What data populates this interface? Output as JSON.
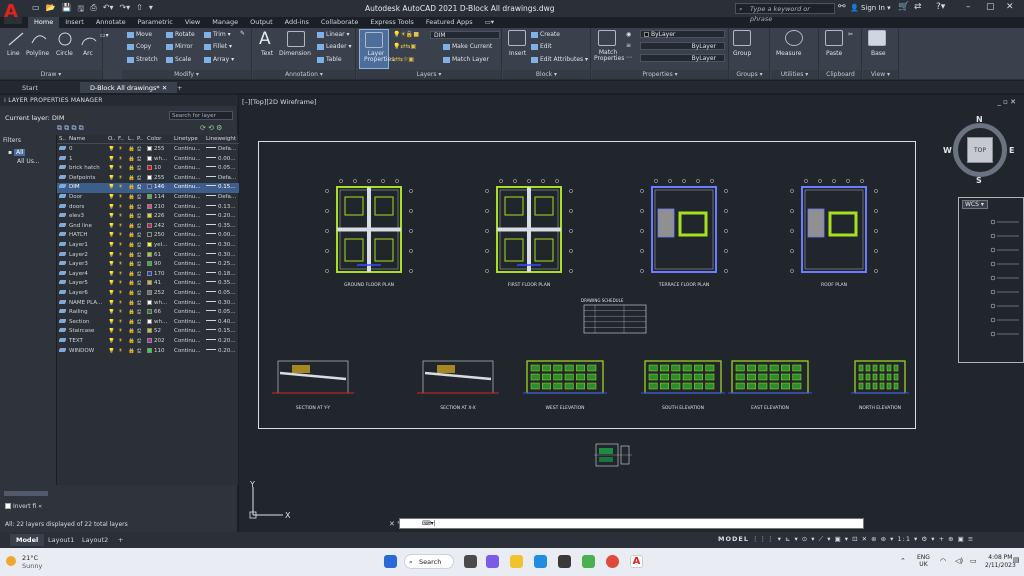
{
  "app": {
    "title": "Autodesk AutoCAD 2021   D-Block All drawings.dwg",
    "search_placeholder": "Type a keyword or phrase",
    "signin": "Sign In"
  },
  "ribbon_tabs": [
    "Home",
    "Insert",
    "Annotate",
    "Parametric",
    "View",
    "Manage",
    "Output",
    "Add-ins",
    "Collaborate",
    "Express Tools",
    "Featured Apps"
  ],
  "draw": {
    "line": "Line",
    "polyline": "Polyline",
    "circle": "Circle",
    "arc": "Arc",
    "label": "Draw ▾"
  },
  "modify": {
    "move": "Move",
    "rotate": "Rotate",
    "trim": "Trim ▾",
    "copy": "Copy",
    "mirror": "Mirror",
    "fillet": "Fillet ▾",
    "stretch": "Stretch",
    "scale": "Scale",
    "array": "Array ▾",
    "label": "Modify ▾"
  },
  "annotation": {
    "text": "Text",
    "dimension": "Dimension",
    "linear": "Linear ▾",
    "leader": "Leader ▾",
    "table": "Table",
    "label": "Annotation ▾"
  },
  "layers": {
    "layer_properties": "Layer Properties",
    "current": "DIM",
    "make_current": "Make Current",
    "match_layer": "Match Layer",
    "label": "Layers ▾"
  },
  "block": {
    "insert": "Insert",
    "create": "Create",
    "edit": "Edit",
    "edit_attributes": "Edit Attributes ▾",
    "label": "Block ▾"
  },
  "properties": {
    "match": "Match Properties",
    "color": "ByLayer",
    "linetype": "ByLayer",
    "lineweight": "ByLayer",
    "label": "Properties ▾"
  },
  "groups": {
    "group": "Group",
    "label": "Groups ▾"
  },
  "utilities": {
    "measure": "Measure",
    "label": "Utilities ▾"
  },
  "clipboard": {
    "paste": "Paste",
    "label": "Clipboard"
  },
  "view_panel": {
    "base": "Base",
    "label": "View ▾"
  },
  "doc_tabs": [
    "Start",
    "D-Block All drawings*"
  ],
  "lpm": {
    "title": "LAYER PROPERTIES MANAGER",
    "current": "Current layer: DIM",
    "search": "Search for layer",
    "filters_label": "Filters",
    "filter_all": "All",
    "filter_used": "All Us...",
    "headers": {
      "s": "S..",
      "name": "Name",
      "o": "O..",
      "f": "F..",
      "l": "L..",
      "p": "P..",
      "color": "Color",
      "linetype": "Linetype",
      "lineweight": "Lineweight"
    },
    "layers": [
      {
        "name": "0",
        "color": "255",
        "swatch": "#ffffff",
        "lt": "Continu...",
        "lw": "Defa..."
      },
      {
        "name": "1",
        "color": "wh...",
        "swatch": "#ffffff",
        "lt": "Continu...",
        "lw": "0.00..."
      },
      {
        "name": "brick hatch",
        "color": "10",
        "swatch": "#ff0000",
        "lt": "Continu...",
        "lw": "0.05..."
      },
      {
        "name": "Defpoints",
        "color": "255",
        "swatch": "#ffffff",
        "lt": "Continu...",
        "lw": "Defa..."
      },
      {
        "name": "DIM",
        "color": "146",
        "swatch": "#3040c0",
        "lt": "Continu...",
        "lw": "0.15..."
      },
      {
        "name": "Door",
        "color": "114",
        "swatch": "#40c040",
        "lt": "Continu...",
        "lw": "Defa..."
      },
      {
        "name": "doors",
        "color": "210",
        "swatch": "#e040a0",
        "lt": "Continu...",
        "lw": "0.13..."
      },
      {
        "name": "elev3",
        "color": "226",
        "swatch": "#e0e000",
        "lt": "Continu...",
        "lw": "0.20..."
      },
      {
        "name": "Gnd line",
        "color": "242",
        "swatch": "#c02050",
        "lt": "Continu...",
        "lw": "0.35..."
      },
      {
        "name": "HATCH",
        "color": "250",
        "swatch": "#303030",
        "lt": "Continu...",
        "lw": "0.00..."
      },
      {
        "name": "Layer1",
        "color": "yel...",
        "swatch": "#ffff00",
        "lt": "Continu...",
        "lw": "0.30..."
      },
      {
        "name": "Layer2",
        "color": "61",
        "swatch": "#a0d020",
        "lt": "Continu...",
        "lw": "0.30..."
      },
      {
        "name": "Layer3",
        "color": "90",
        "swatch": "#20c020",
        "lt": "Continu...",
        "lw": "0.25..."
      },
      {
        "name": "Layer4",
        "color": "170",
        "swatch": "#2040c0",
        "lt": "Continu...",
        "lw": "0.18..."
      },
      {
        "name": "Layer5",
        "color": "41",
        "swatch": "#e0b020",
        "lt": "Continu...",
        "lw": "0.35..."
      },
      {
        "name": "Layer6",
        "color": "252",
        "swatch": "#707070",
        "lt": "Continu...",
        "lw": "0.05..."
      },
      {
        "name": "NAME PLA...",
        "color": "wh...",
        "swatch": "#ffffff",
        "lt": "Continu...",
        "lw": "0.30..."
      },
      {
        "name": "Railing",
        "color": "66",
        "swatch": "#208020",
        "lt": "Continu...",
        "lw": "0.05..."
      },
      {
        "name": "Section",
        "color": "wh...",
        "swatch": "#ffffff",
        "lt": "Continu...",
        "lw": "0.40..."
      },
      {
        "name": "Staircase",
        "color": "52",
        "swatch": "#d0c020",
        "lt": "Continu...",
        "lw": "0.15..."
      },
      {
        "name": "TEXT",
        "color": "202",
        "swatch": "#c020c0",
        "lt": "Continu...",
        "lw": "0.20..."
      },
      {
        "name": "WINDOW",
        "color": "110",
        "swatch": "#20e040",
        "lt": "Continu...",
        "lw": "0.20..."
      }
    ],
    "invert": "Invert fi",
    "footer": "All: 22 layers displayed of 22 total layers"
  },
  "viewport": {
    "label": "[–][Top][2D Wireframe]",
    "compass": {
      "n": "N",
      "s": "S",
      "e": "E",
      "w": "W",
      "top": "TOP"
    },
    "wcs": "WCS ▾",
    "drawings": {
      "plans": [
        "GROUND FLOOR PLAN",
        "FIRST FLOOR PLAN",
        "TERRACE FLOOR PLAN",
        "ROOF PLAN"
      ],
      "schedule": "DRAWING SCHEDULE",
      "elevations": [
        "SECTION AT Y-Y",
        "SECTION AT X-X",
        "WEST ELEVATION",
        "SOUTH ELEVATION",
        "EAST ELEVATION",
        "NORTH ELEVATION"
      ]
    },
    "ucs_x": "X",
    "ucs_y": "Y"
  },
  "cmd": {
    "prompt": "⌨▾|"
  },
  "model_tabs": [
    "Model",
    "Layout1",
    "Layout2"
  ],
  "status": {
    "model": "MODEL",
    "scale": "1:1 ▾"
  },
  "taskbar": {
    "temp": "21°C",
    "weather": "Sunny",
    "search": "Search",
    "lang1": "ENG",
    "lang2": "UK",
    "time": "4:08 PM",
    "date": "2/11/2023"
  }
}
